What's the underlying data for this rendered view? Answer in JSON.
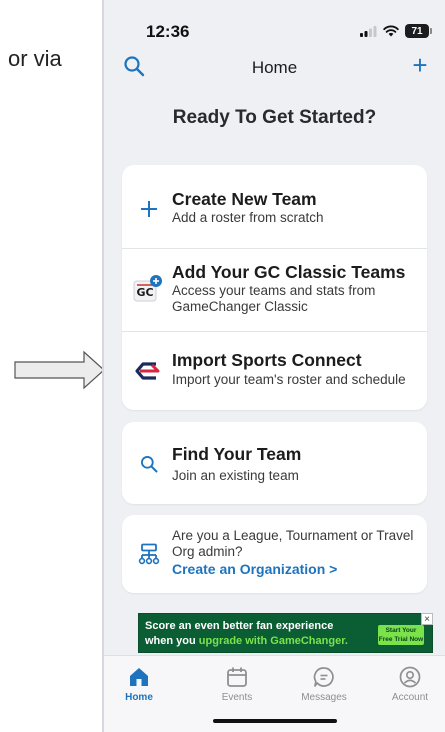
{
  "annotation": {
    "side_text": "or via"
  },
  "status_bar": {
    "time": "12:36",
    "battery": "71"
  },
  "nav": {
    "title": "Home",
    "add_symbol": "+"
  },
  "heading": "Ready To Get Started?",
  "options": [
    {
      "title": "Create New Team",
      "subtitle": "Add a roster from scratch",
      "icon": "plus-icon"
    },
    {
      "title": "Add Your GC Classic Teams",
      "subtitle": "Access your teams and stats from GameChanger Classic",
      "icon": "gc-classic-icon",
      "icon_text": "GC"
    },
    {
      "title": "Import Sports Connect",
      "subtitle": "Import your team's roster and schedule",
      "icon": "sports-connect-icon"
    }
  ],
  "find_team": {
    "title": "Find Your Team",
    "subtitle": "Join an existing team",
    "icon": "search-icon"
  },
  "organization": {
    "text": "Are you a League, Tournament or Travel Org admin?",
    "link": "Create an Organization  >",
    "icon": "org-chart-icon"
  },
  "ad": {
    "line1": "Score an even better fan experience",
    "line2_prefix": "when you ",
    "line2_highlight": "upgrade with GameChanger.",
    "cta": "Start Your Free Trial Now →",
    "close": "×"
  },
  "tabs": [
    {
      "label": "Home",
      "icon": "home-icon",
      "active": true
    },
    {
      "label": "Events",
      "icon": "calendar-icon",
      "active": false
    },
    {
      "label": "Messages",
      "icon": "chat-icon",
      "active": false
    },
    {
      "label": "Account",
      "icon": "account-icon",
      "active": false
    }
  ],
  "colors": {
    "accent": "#1e73be",
    "background": "#eef0f4",
    "card": "#ffffff",
    "ad_green": "#0b5e34",
    "ad_highlight": "#7be34a",
    "sports_connect_red": "#d7263d",
    "sports_connect_navy": "#1b2a5c"
  }
}
